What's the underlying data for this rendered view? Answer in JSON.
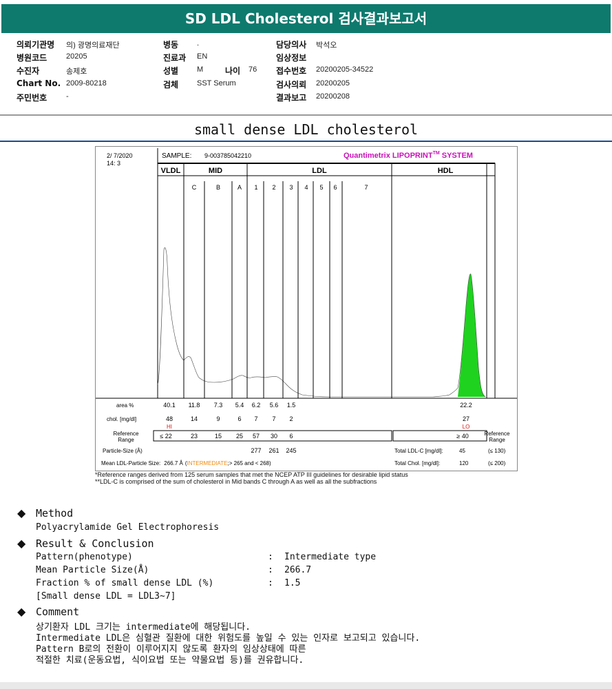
{
  "title": "SD LDL Cholesterol 검사결과보고서",
  "header": {
    "col1": [
      {
        "label": "의뢰기관명",
        "value": "의) 광명의료재단"
      },
      {
        "label": "병원코드",
        "value": "20205"
      },
      {
        "label": "수진자",
        "value": "송제호"
      },
      {
        "label": "Chart No.",
        "value": "2009-80218"
      },
      {
        "label": "주민번호",
        "value": "-"
      }
    ],
    "col2": [
      {
        "label": "병동",
        "value": "."
      },
      {
        "label": "진료과",
        "value": "EN"
      },
      {
        "label": "성별",
        "value": "M"
      },
      {
        "label": "검체",
        "value": "SST Serum"
      }
    ],
    "age": {
      "label": "나이",
      "value": "76"
    },
    "col3": [
      {
        "label": "담당의사",
        "value": "박석오"
      },
      {
        "label": "임상정보",
        "value": ""
      },
      {
        "label": "접수번호",
        "value": "20200205-34522"
      },
      {
        "label": "검사의뢰",
        "value": "20200205"
      },
      {
        "label": "결과보고",
        "value": "20200208"
      }
    ]
  },
  "section_title": "small dense LDL cholesterol",
  "report": {
    "date": "2/ 7/2020",
    "time": "14: 3",
    "sample_label": "SAMPLE:",
    "sample_id": "9-003785042210",
    "brand": "Quantimetrix LIPOPRINT",
    "brand_tm": "TM",
    "brand_system": " SYSTEM",
    "groups": [
      "VLDL",
      "MID",
      "LDL",
      "HDL"
    ],
    "bands": [
      "C",
      "B",
      "A",
      "1",
      "2",
      "3",
      "4",
      "5",
      "6",
      "7"
    ],
    "area_label": "area %",
    "area_values": [
      "40.1",
      "11.8",
      "7.3",
      "5.4",
      "6.2",
      "5.6",
      "1.5"
    ],
    "area_hdl": "22.2",
    "chol_label": "chol. [mg/dl]",
    "chol_values": [
      "48",
      "14",
      "9",
      "6",
      "7",
      "7",
      "2"
    ],
    "chol_hdl": "27",
    "hi_flag": "HI",
    "lo_flag": "LO",
    "ref_label_1": "Reference",
    "ref_label_2": "Range",
    "ref_values": [
      "≤ 22",
      "23",
      "15",
      "25",
      "57",
      "30",
      "6"
    ],
    "ref_hdl": "≥ 40",
    "particle_size_label": "Particle-Size (Å)",
    "particle_sizes": [
      "277",
      "261",
      "245"
    ],
    "total_ldl_label": "Total LDL-C [mg/dl]:",
    "total_ldl_value": "45",
    "total_ldl_ref": "(≤ 130)",
    "mean_label": "Mean LDL-Particle Size:",
    "mean_value": "266.7 Å",
    "mean_class_open": "(",
    "mean_class": "INTERMEDIATE",
    "mean_class_close": ";> 265 and < 268)",
    "total_chol_label": "Total Chol. [mg/dl]:",
    "total_chol_value": "120",
    "total_chol_ref": "(≤ 200)",
    "colors": {
      "vldl": "#cc1ae6",
      "c": "#8a22e8",
      "b": "#2a7de6",
      "a": "#1e5ed6",
      "ldl1": "#f2c21a",
      "ldl2": "#f2c21a",
      "ldl3": "#f08a10",
      "ldl4": "#e61a3c",
      "ldl5": "#e61a6a",
      "hdl": "#1fd21f",
      "brand": "#c812b8",
      "ref_red": "#d81a1a",
      "intermediate": "#f08a10"
    }
  },
  "footnote_1": "*Reference ranges derived from 125 serum samples that met the NCEP ATP III guidelines for desirable lipid status",
  "footnote_2": "**LDL-C is comprised of the sum of cholesterol in Mid bands C through A as well as all the subfractions",
  "method": {
    "heading": "Method",
    "text": "Polyacrylamide Gel Electrophoresis"
  },
  "result": {
    "heading": "Result & Conclusion",
    "rows": [
      {
        "label": "Pattern(phenotype)",
        "value": "Intermediate type"
      },
      {
        "label": "Mean Particle Size(Å)",
        "value": "266.7"
      },
      {
        "label": "Fraction % of small dense LDL (%)",
        "value": "1.5"
      }
    ],
    "note": "[Small dense LDL = LDL3~7]",
    "separator": ":"
  },
  "comment": {
    "heading": "Comment",
    "lines": [
      "상기환자 LDL 크기는 intermediate에 해당됩니다.",
      "Intermediate LDL은 심혈관 질환에 대한 위험도를 높일 수 있는 인자로 보고되고 있습니다.",
      "Pattern B로의 전환이 이루어지지 않도록 환자의 임상상태에 따른",
      "적절한 치료(운동요법, 식이요법 또는 약물요법 등)를 권유합니다."
    ]
  }
}
